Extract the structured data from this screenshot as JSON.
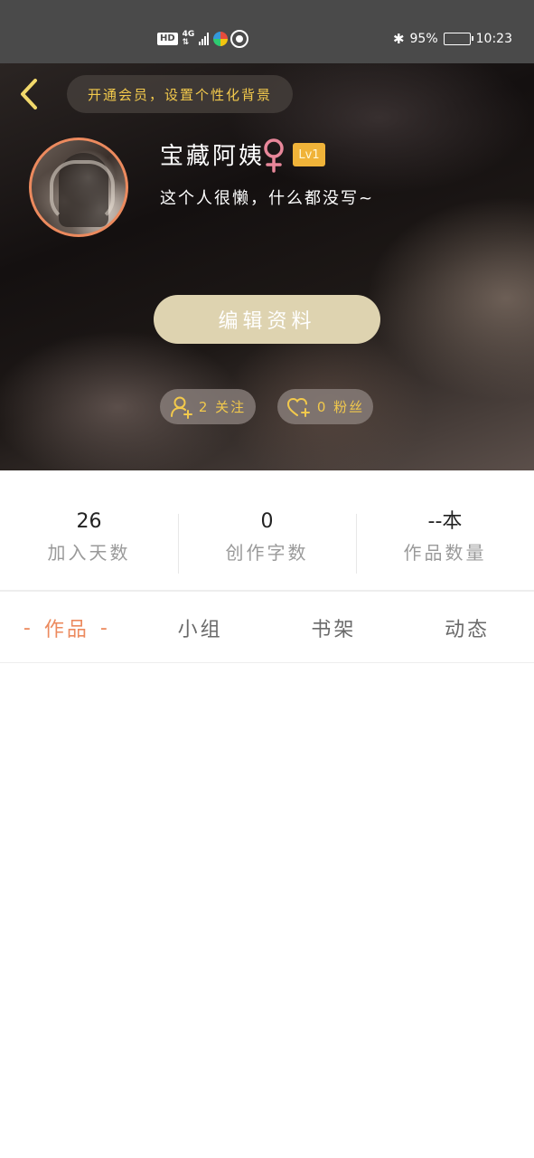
{
  "status_bar": {
    "hd": "HD",
    "network": "4G",
    "battery_percent": "95%",
    "battery_level": 0.95,
    "time": "10:23",
    "icons": [
      "hd-icon",
      "4g-icon",
      "signal-icon",
      "app-colorful-icon",
      "app-shutter-icon",
      "bluetooth-icon",
      "battery-icon"
    ]
  },
  "header": {
    "back_icon": "chevron-left-icon",
    "vip_banner": "开通会员，设置个性化背景",
    "username": "宝藏阿姨",
    "gender_icon": "female-icon",
    "level": "Lv1",
    "bio": "这个人很懒，什么都没写~",
    "edit_button": "编辑资料",
    "follow": {
      "icon": "add-user-icon",
      "text": "2 关注"
    },
    "fans": {
      "icon": "heart-plus-icon",
      "text": "0 粉丝"
    },
    "accent_color": "#f2c94c"
  },
  "stats": [
    {
      "value": "26",
      "label": "加入天数"
    },
    {
      "value": "0",
      "label": "创作字数"
    },
    {
      "value": "--本",
      "label": "作品数量"
    }
  ],
  "tabs": [
    {
      "label": "作品",
      "active": true,
      "dash": "-"
    },
    {
      "label": "小组",
      "active": false
    },
    {
      "label": "书架",
      "active": false
    },
    {
      "label": "动态",
      "active": false
    }
  ],
  "colors": {
    "active_tab": "#ec8a5e",
    "avatar_border": "#ec8a5e",
    "level_badge": "#f0b339",
    "edit_button_bg": "#ded3b0"
  }
}
